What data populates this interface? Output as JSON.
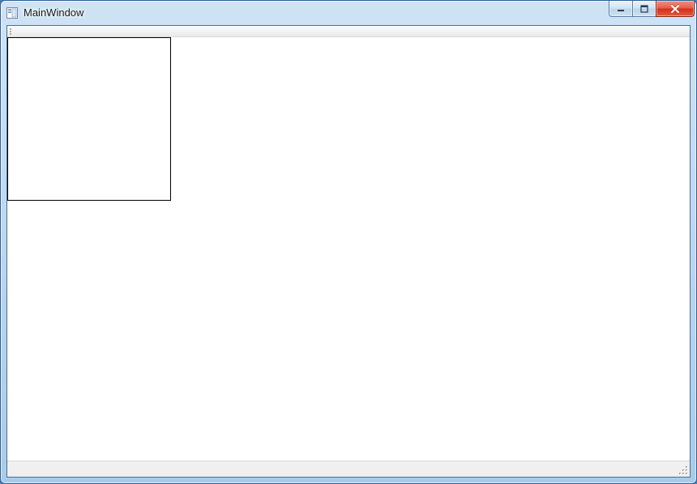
{
  "window": {
    "title": "MainWindow"
  }
}
